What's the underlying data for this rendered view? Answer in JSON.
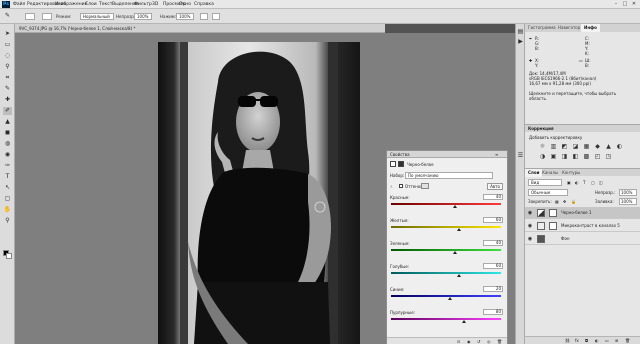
{
  "app": {
    "logo": "Ps"
  },
  "menu": [
    "Файл",
    "Редактирование",
    "Изображение",
    "Слои",
    "Текст",
    "Выделение",
    "Фильтр",
    "3D",
    "Просмотр",
    "Окно",
    "Справка"
  ],
  "window_controls": {
    "minimize": "–",
    "maximize": "□",
    "close": "✕"
  },
  "options_bar": {
    "mode_label": "Режим:",
    "mode_value": "Нормальный",
    "opacity_label": "Непрозр.:",
    "opacity_value": "100%",
    "flow_label": "Нажим:",
    "flow_value": "100%"
  },
  "document": {
    "tab_title": "9VC_9374.JPG @ 16,7% (Черно-белое 1, Слой-маска/8) *"
  },
  "properties": {
    "title": "Свойства",
    "subtitle": "Черно-белое",
    "preset_label": "Набор:",
    "preset_value": "По умолчанию",
    "tint_label": "Оттенок",
    "auto_label": "Авто",
    "sliders": [
      {
        "name": "Красные:",
        "value": "40",
        "level": 0.58,
        "c1": "#6b0000",
        "c2": "#ff3b3b"
      },
      {
        "name": "Желтые:",
        "value": "60",
        "level": 0.62,
        "c1": "#6b6b00",
        "c2": "#ffe600"
      },
      {
        "name": "Зеленые:",
        "value": "40",
        "level": 0.58,
        "c1": "#005a00",
        "c2": "#40e040"
      },
      {
        "name": "Голубые:",
        "value": "60",
        "level": 0.62,
        "c1": "#005a5a",
        "c2": "#30e6e6"
      },
      {
        "name": "Синие:",
        "value": "20",
        "level": 0.54,
        "c1": "#00005a",
        "c2": "#4040ff"
      },
      {
        "name": "Пурпурные:",
        "value": "80",
        "level": 0.66,
        "c1": "#5a005a",
        "c2": "#ff40ff"
      }
    ]
  },
  "histogram_panel": {
    "tabs": [
      "Гистограмма",
      "Навигатор",
      "Инфо"
    ],
    "rgb": [
      "R:",
      "G:",
      "B:"
    ],
    "cmyk": [
      "C:",
      "M:",
      "Y:",
      "K:"
    ],
    "xy": [
      "X:",
      "Y:"
    ],
    "wh": [
      "Ш:",
      "В:"
    ],
    "doc_info": "Док: 14,4M/17,4M",
    "doc_info2": "sRGB IEC61966-2.1 (8бит/канал)",
    "doc_info3": "16,67 мм x 91,28 мм (300 ppi)",
    "hint": "Щелкните и перетащите, чтобы выбрать область."
  },
  "adjustments": {
    "title": "Коррекция",
    "subtitle": "Добавить корректировку",
    "icons": [
      "☼",
      "▥",
      "◩",
      "◪",
      "▦",
      "◆",
      "▲",
      "◐",
      "◑",
      "▣",
      "◨",
      "◧",
      "▩",
      "◰",
      "◳"
    ]
  },
  "layers": {
    "tabs": [
      "Слои",
      "Каналы",
      "Контуры"
    ],
    "kind_label": "Вид",
    "blend_mode": "Обычные",
    "opacity_label": "Непрозр.:",
    "opacity_value": "100%",
    "lock_label": "Закрепить:",
    "fill_label": "Заливка:",
    "fill_value": "100%",
    "items": [
      {
        "name": "Черно-белое 1",
        "selected": true,
        "type": "adjustment"
      },
      {
        "name": "Микроконтраст в каналах 5",
        "selected": false,
        "type": "mask"
      },
      {
        "name": "Фон",
        "selected": false,
        "type": "photo"
      }
    ]
  },
  "tools": [
    "➤",
    "▭",
    "◌",
    "⚲",
    "⌗",
    "✎",
    "✚",
    "✐",
    "▲",
    "◼",
    "◍",
    "◉",
    "✑",
    "T",
    "↖",
    "▢",
    "✋",
    "⚲"
  ],
  "colors": {
    "accent": "#31a8ff",
    "selected": "#c6c6c6"
  }
}
